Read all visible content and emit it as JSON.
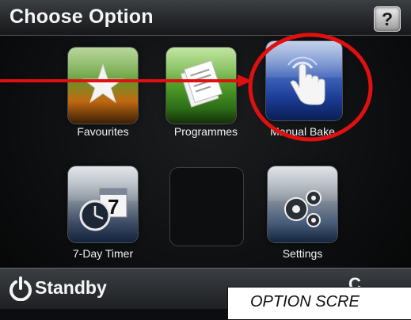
{
  "header": {
    "title": "Choose Option",
    "help_label": "?"
  },
  "tiles": [
    {
      "label": "Favourites",
      "icon": "star-icon"
    },
    {
      "label": "Programmes",
      "icon": "document-icon"
    },
    {
      "label": "Manual Bake",
      "icon": "hand-touch-icon"
    },
    {
      "label": "7-Day Timer",
      "icon": "clock-calendar-icon",
      "calendar_number": "7"
    },
    {
      "label": "",
      "icon": ""
    },
    {
      "label": "Settings",
      "icon": "gears-icon"
    }
  ],
  "footer": {
    "standby_label": "Standby",
    "right_fragment": "C"
  },
  "annotation": {
    "caption": "OPTION SCRE",
    "highlight_color": "#e01010"
  }
}
